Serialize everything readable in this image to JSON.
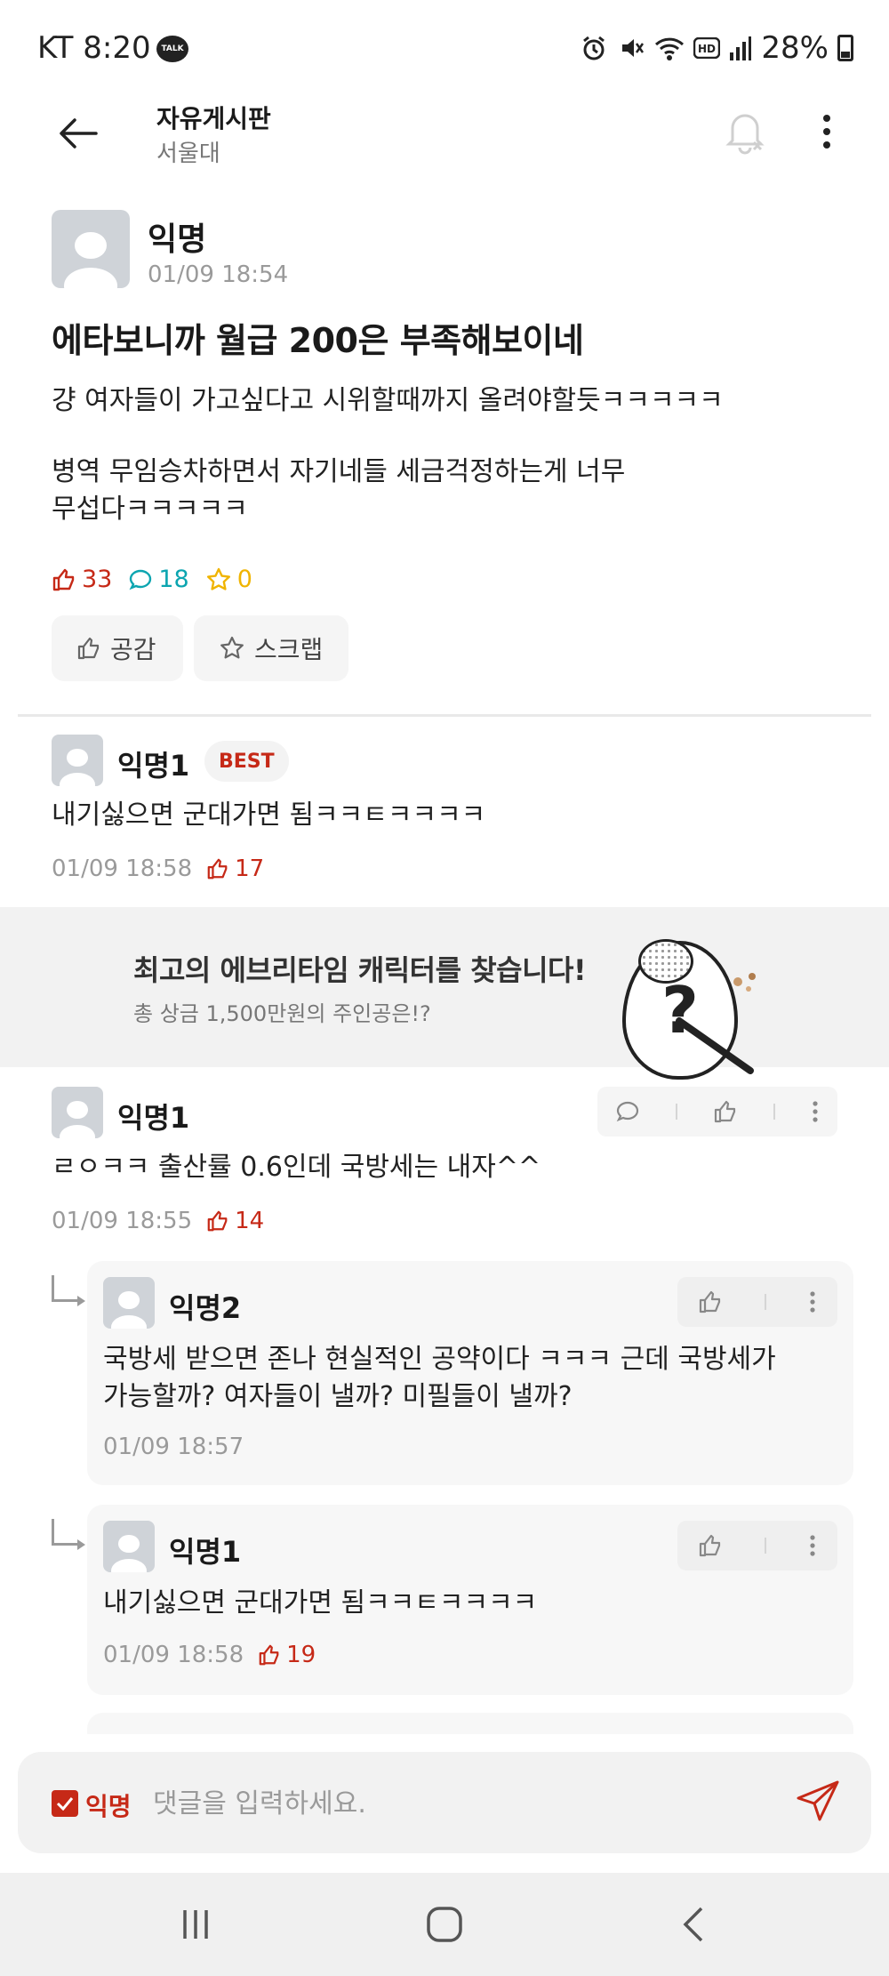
{
  "status_bar": {
    "carrier_time": "KT 8:20",
    "talk_badge": "TALK",
    "battery": "28%"
  },
  "header": {
    "title": "자유게시판",
    "subtitle": "서울대"
  },
  "post": {
    "author": "익명",
    "time": "01/09 18:54",
    "title": "에타보니까 월급 200은 부족해보이네",
    "body": [
      "걍 여자들이 가고싶다고 시위할때까지 올려야할듯ㅋㅋㅋㅋㅋ",
      "병역 무임승차하면서 자기네들 세금걱정하는게 너무\n무섭다ㅋㅋㅋㅋㅋ"
    ],
    "likes": "33",
    "comments": "18",
    "scraps": "0",
    "like_button": "공감",
    "scrap_button": "스크랩"
  },
  "best_comment": {
    "author": "익명1",
    "badge": "BEST",
    "text": "내기싫으면 군대가면 됨ㅋㅋㅌㅋㅋㅋㅋ",
    "time": "01/09 18:58",
    "likes": "17"
  },
  "banner": {
    "title": "최고의 에브리타임 캐릭터를 찾습니다!",
    "subtitle": "총 상금 1,500만원의 주인공은!?",
    "egg_mark": "?"
  },
  "comments": [
    {
      "author": "익명1",
      "text": "ㄹㅇㅋㅋ 출산률 0.6인데 국방세는 내자^^",
      "time": "01/09 18:55",
      "likes": "14"
    }
  ],
  "replies": [
    {
      "author": "익명2",
      "text": "국방세 받으면 존나 현실적인 공약이다 ㅋㅋㅋ 근데 국방세가\n가능할까? 여자들이 낼까? 미필들이 낼까?",
      "time": "01/09 18:57"
    },
    {
      "author": "익명1",
      "text": "내기싫으면 군대가면 됨ㅋㅋㅌㅋㅋㅋㅋ",
      "time": "01/09 18:58",
      "likes": "19"
    }
  ],
  "input": {
    "anon_label": "익명",
    "placeholder": "댓글을 입력하세요."
  },
  "colors": {
    "accent": "#c62917",
    "comment": "#0ca5b0",
    "scrap": "#f0b400"
  }
}
